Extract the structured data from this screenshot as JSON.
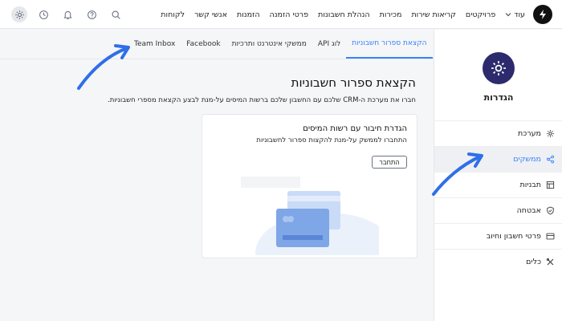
{
  "nav": {
    "links": [
      "לקוחות",
      "אנשי קשר",
      "הזמנות",
      "פרטי הזמנה",
      "הנהלת חשבונות",
      "מכירות",
      "קריאות שירות",
      "פרויקטים"
    ],
    "more_label": "עוד"
  },
  "sidebar": {
    "title": "הגדרות",
    "items": [
      {
        "label": "מערכת",
        "icon": "gear-icon"
      },
      {
        "label": "ממשקים",
        "icon": "share-icon"
      },
      {
        "label": "תבניות",
        "icon": "template-icon"
      },
      {
        "label": "אבטחה",
        "icon": "shield-icon"
      },
      {
        "label": "פרטי חשבון וחיוב",
        "icon": "billing-icon"
      },
      {
        "label": "כלים",
        "icon": "tools-icon"
      }
    ],
    "active_index": 1
  },
  "tabs": [
    "Team Inbox",
    "Facebook",
    "ממשקי אינטרנט ותרכיות",
    "לוג API",
    "הקצאת ספרור חשבוניות"
  ],
  "active_tab_index": 4,
  "page": {
    "title": "הקצאת ספרור חשבוניות",
    "description": "חברו את מערכת ה-CRM שלכם עם החשבון שלכם ברשות המיסים על-מנת לבצע הקצאת מספרי חשבוניות."
  },
  "card": {
    "title": "הגדרת חיבור עם רשות המיסים",
    "subtitle": "התחברו לממשק על-מנת להקצות ספרור לחשבוניות",
    "button_label": "התחבר"
  },
  "colors": {
    "accent": "#3b82f6",
    "avatar_bg": "#2d2a6e"
  }
}
